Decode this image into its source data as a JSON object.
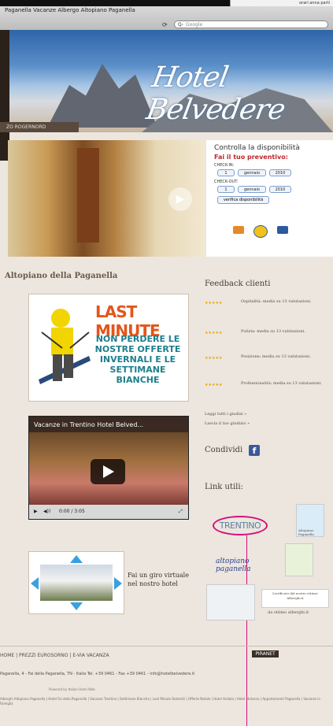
{
  "topbar": {
    "right_text": "orari anna parti"
  },
  "browser": {
    "tab_title": "Paganella Vacanze Albergo Altopiano Paganella",
    "search_placeholder": "Google",
    "search_prefix": "Q-"
  },
  "header": {
    "logo_text": "Hotel Belvedere",
    "nav_label": "ZO ROGERNORD"
  },
  "availability": {
    "title": "Controlla la disponibilità",
    "subtitle": "Fai il tuo preventivo:",
    "checkin_label": "CHECK-IN:",
    "checkin_day": "1",
    "checkin_month": "gennaio",
    "checkin_year": "2010",
    "checkout_label": "CHECK-OUT:",
    "checkout_day": "1",
    "checkout_month": "gennaio",
    "checkout_year": "2010",
    "button": "verifica disponibilità"
  },
  "main": {
    "title": "Altopiano della Paganella",
    "last_minute_title": "LAST MINUTE",
    "last_minute_text": "NON PERDERE LE NOSTRE OFFERTE INVERNALI E LE SETTIMANE BIANCHE",
    "video_title": "Vacanze in Trentino Hotel Belved...",
    "video_time": "0:00 / 3:05",
    "tour_text": "Fai un giro virtuale nel nostro hotel"
  },
  "sidebar": {
    "feedback_title": "Feedback clienti",
    "feedback": [
      {
        "stars": "★★★★★",
        "text": "Ospitalità: media su 13 valutazioni."
      },
      {
        "stars": "★★★★★",
        "text": "Pulizia: media su 13 valutazioni."
      },
      {
        "stars": "★★★★★",
        "text": "Posizione: media su 13 valutazioni."
      },
      {
        "stars": "★★★★★",
        "text": "Professionalità: media su 13 valutazioni."
      }
    ],
    "read_link": "Leggi tutti i giudizi »",
    "write_link": "Lascia il tuo giudizio »",
    "share_label": "Condividi",
    "links_title": "Link utili:",
    "trentino_text": "TRENTINO",
    "logo_texts": [
      "Altopiano Paganella",
      "altopiano paganella",
      "Certificato dal nostro ottimo-Alberghi.it",
      "da ottimo alberghi.it"
    ]
  },
  "footer": {
    "nav": "HOME  |  PREZZI EUROSORNO  |  E-VIA VACANZA",
    "address": "Paganella, 4 - Fai della Paganella, TN - Italia Tel. +39 0461 - Fax +39 0461 - info@hotelbelvedere.it",
    "credit": "Powered by Italian Hotel Web",
    "seo": "Alberghi Altopiano Paganella | Hotel Fai della Paganella | Vacanze Trentino | Settimane Bianche | Last Minute Dolomiti | Offerte Natale | Hotel Andalo | Hotel Molveno | Appartamenti Paganella | Vacanze in Famiglia",
    "badge": "PIRANET"
  }
}
